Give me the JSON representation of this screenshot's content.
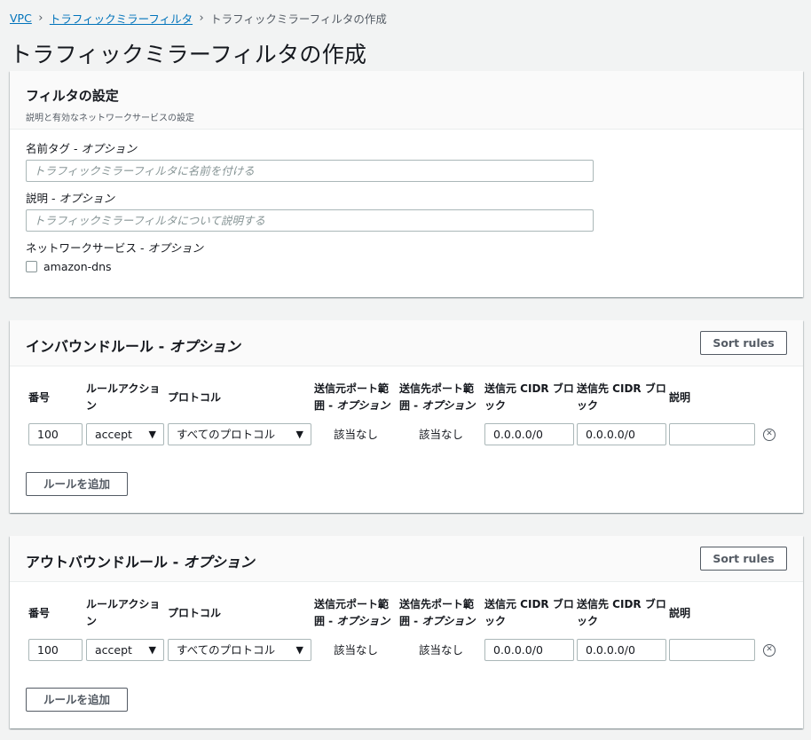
{
  "breadcrumb": {
    "items": [
      "VPC",
      "トラフィックミラーフィルタ"
    ],
    "current": "トラフィックミラーフィルタの作成"
  },
  "page_title": "トラフィックミラーフィルタの作成",
  "filter_settings": {
    "title": "フィルタの設定",
    "description": "説明と有効なネットワークサービスの設定",
    "name_tag_label": "名前タグ - ",
    "name_tag_optional": "オプション",
    "name_tag_placeholder": "トラフィックミラーフィルタに名前を付ける",
    "description_label": "説明 - ",
    "description_optional": "オプション",
    "description_placeholder": "トラフィックミラーフィルタについて説明する",
    "network_services_label": "ネットワークサービス - ",
    "network_services_optional": "オプション",
    "network_service_option": "amazon-dns"
  },
  "inbound": {
    "title": "インバウンドルール - ",
    "title_optional": "オプション",
    "sort_button": "Sort rules",
    "headers": {
      "number": "番号",
      "action_1": "ルールアクショ",
      "action_2": "ン",
      "protocol": "プロトコル",
      "src_port_1": "送信元ポート範",
      "src_port_2": "囲 - ",
      "src_port_opt": "オプション",
      "dst_port_1": "送信先ポート範",
      "dst_port_2": "囲 - ",
      "dst_port_opt": "オプション",
      "src_cidr_1": "送信元 CIDR ブロ",
      "src_cidr_2": "ック",
      "dst_cidr_1": "送信先 CIDR ブロ",
      "dst_cidr_2": "ック",
      "description": "説明"
    },
    "row": {
      "number": "100",
      "action": "accept",
      "protocol": "すべてのプロトコル",
      "src_port": "該当なし",
      "dst_port": "該当なし",
      "src_cidr": "0.0.0.0/0",
      "dst_cidr": "0.0.0.0/0",
      "description": ""
    },
    "add_button": "ルールを追加"
  },
  "outbound": {
    "title": "アウトバウンドルール - ",
    "title_optional": "オプション",
    "sort_button": "Sort rules",
    "headers": {
      "number": "番号",
      "action_1": "ルールアクショ",
      "action_2": "ン",
      "protocol": "プロトコル",
      "src_port_1": "送信元ポート範",
      "src_port_2": "囲 - ",
      "src_port_opt": "オプション",
      "dst_port_1": "送信先ポート範",
      "dst_port_2": "囲 - ",
      "dst_port_opt": "オプション",
      "src_cidr_1": "送信元 CIDR ブロ",
      "src_cidr_2": "ック",
      "dst_cidr_1": "送信先 CIDR ブロ",
      "dst_cidr_2": "ック",
      "description": "説明"
    },
    "row": {
      "number": "100",
      "action": "accept",
      "protocol": "すべてのプロトコル",
      "src_port": "該当なし",
      "dst_port": "該当なし",
      "src_cidr": "0.0.0.0/0",
      "dst_cidr": "0.0.0.0/0",
      "description": ""
    },
    "add_button": "ルールを追加"
  },
  "icons": {
    "dropdown": "caret-down-icon",
    "remove": "circle-x-icon",
    "breadcrumb_separator": "chevron-right-icon"
  },
  "colors": {
    "link": "#0073bb",
    "background": "#f2f3f3",
    "border": "#aab7b8"
  }
}
